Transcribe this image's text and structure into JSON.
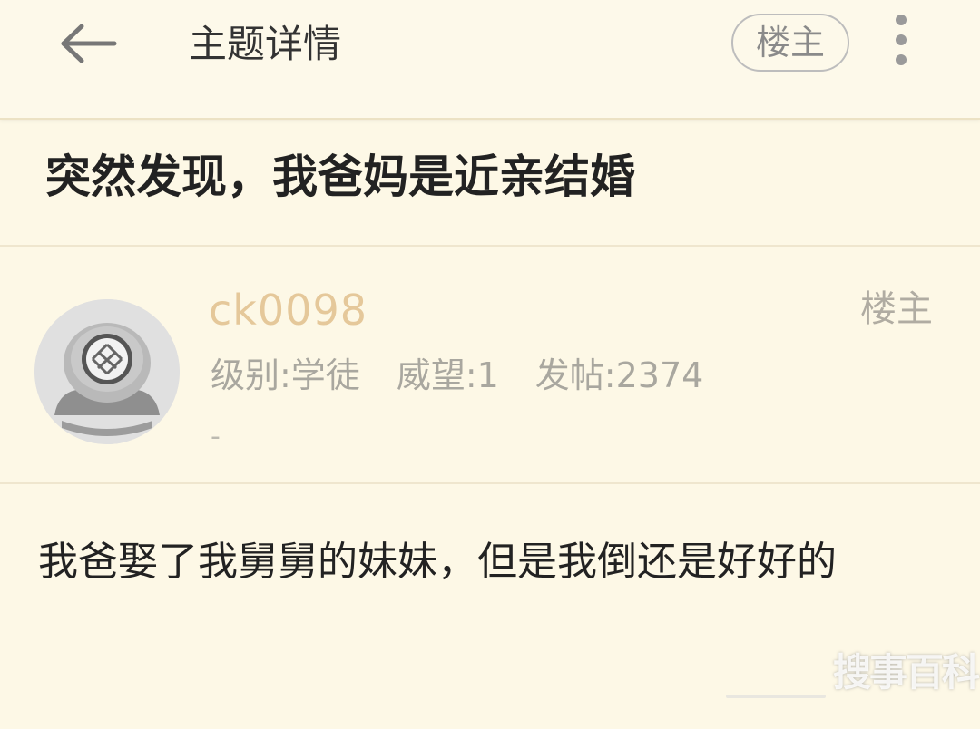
{
  "header": {
    "back_icon": "arrow-left-icon",
    "title": "主题详情",
    "owner_filter_label": "楼主",
    "more_icon": "more-vertical-icon"
  },
  "thread": {
    "title": "突然发现，我爸妈是近亲结婚"
  },
  "post": {
    "username": "ck0098",
    "floor_label": "楼主",
    "level": "级别:学徒",
    "reputation": "威望:1",
    "post_count": "发帖:2374",
    "signature": "-",
    "body": "我爸娶了我舅舅的妹妹，但是我倒还是好好的"
  },
  "watermark": {
    "text": "搜事百科"
  },
  "colors": {
    "background": "#fdf8e6",
    "username": "#e5c89a",
    "muted_text": "#a9a79f"
  }
}
